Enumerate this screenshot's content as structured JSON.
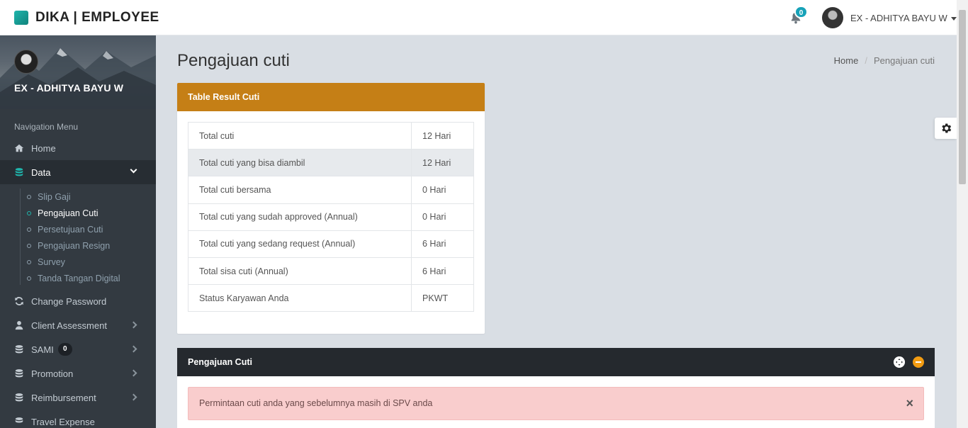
{
  "app": {
    "brand": "DIKA | EMPLOYEE"
  },
  "header": {
    "notification_count": "0",
    "user_name": "EX - ADHITYA BAYU W"
  },
  "sidebar": {
    "profile_name": "EX - ADHITYA BAYU W",
    "nav_header": "Navigation Menu",
    "items": [
      {
        "label": "Home"
      },
      {
        "label": "Data"
      },
      {
        "label": "Change Password"
      },
      {
        "label": "Client Assessment"
      },
      {
        "label": "SAMI",
        "badge": "0"
      },
      {
        "label": "Promotion"
      },
      {
        "label": "Reimbursement"
      },
      {
        "label": "Travel Expense"
      }
    ],
    "data_submenu": [
      {
        "label": "Slip Gaji"
      },
      {
        "label": "Pengajuan Cuti"
      },
      {
        "label": "Persetujuan Cuti"
      },
      {
        "label": "Pengajuan Resign"
      },
      {
        "label": "Survey"
      },
      {
        "label": "Tanda Tangan Digital"
      }
    ]
  },
  "main": {
    "title": "Pengajuan cuti",
    "breadcrumb": {
      "home": "Home",
      "current": "Pengajuan cuti"
    },
    "result_card": {
      "title": "Table Result Cuti",
      "rows": [
        {
          "label": "Total cuti",
          "value": "12 Hari"
        },
        {
          "label": "Total cuti yang bisa diambil",
          "value": "12 Hari"
        },
        {
          "label": "Total cuti bersama",
          "value": "0 Hari"
        },
        {
          "label": "Total cuti yang sudah approved (Annual)",
          "value": "0 Hari"
        },
        {
          "label": "Total cuti yang sedang request (Annual)",
          "value": "6 Hari"
        },
        {
          "label": "Total sisa cuti (Annual)",
          "value": "6 Hari"
        },
        {
          "label": "Status Karyawan Anda",
          "value": "PKWT"
        }
      ]
    },
    "pengajuan_card": {
      "title": "Pengajuan Cuti",
      "alert": "Permintaan cuti anda yang sebelumnya masih di SPV anda",
      "alert_close": "×"
    }
  },
  "colors": {
    "accent": "#1fb5ac",
    "orange_header": "#c57f16",
    "dark_header": "#25292e",
    "alert_bg": "#f9cdcd"
  }
}
